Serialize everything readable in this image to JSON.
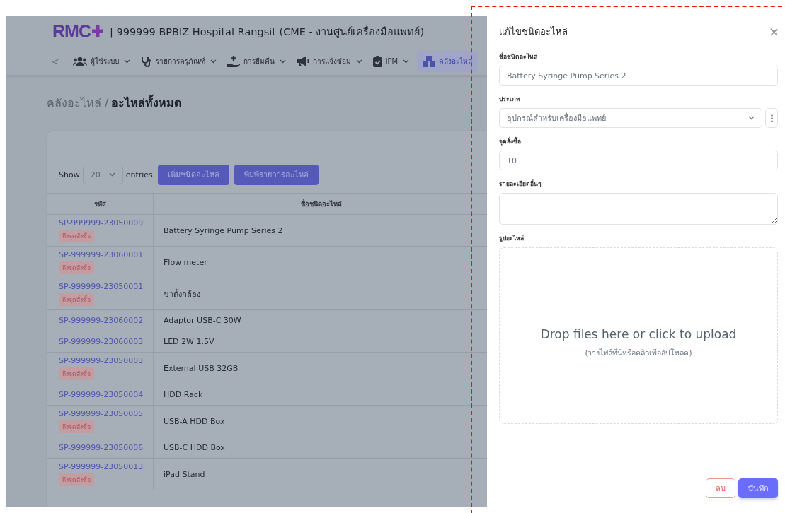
{
  "header": {
    "logo": "RMC",
    "title": "| 999999 BPBIZ Hospital Rangsit (CME - งานศูนย์เครื่องมือแพทย์)"
  },
  "nav": {
    "back": "<",
    "items": [
      {
        "label": "ผู้ใช้ระบบ",
        "selected": false
      },
      {
        "label": "รายการครุภัณฑ์",
        "selected": false
      },
      {
        "label": "การยืมคืน",
        "selected": false
      },
      {
        "label": "การแจ้งซ่อม",
        "selected": false
      },
      {
        "label": "iPM",
        "selected": false
      },
      {
        "label": "คลังอะไหล",
        "selected": true
      }
    ]
  },
  "breadcrumb": {
    "parent": "คลังอะไหล่ /",
    "current": "อะไหล่ทั้งหมด"
  },
  "controls": {
    "show": "Show",
    "page_size": "20",
    "entries": "entries",
    "buttons": [
      "เพิ่มชนิดอะไหล่",
      "พิมพ์รายการอะไหล่"
    ]
  },
  "table": {
    "columns": [
      "รหัส",
      "ชื่อชนิดอะไหล่"
    ],
    "rows": [
      {
        "code": "SP-999999-23050009",
        "badge": "ถึงจุดสั่งซื้อ",
        "name": "Battery Syringe Pump Series 2"
      },
      {
        "code": "SP-999999-23060001",
        "badge": "ถึงจุดสั่งซื้อ",
        "name": "Flow meter"
      },
      {
        "code": "SP-999999-23050001",
        "badge": "ถึงจุดสั่งซื้อ",
        "name": "ขาตั้งกล้อง"
      },
      {
        "code": "SP-999999-23060002",
        "name": "Adaptor USB-C 30W"
      },
      {
        "code": "SP-999999-23060003",
        "name": "LED 2W 1.5V"
      },
      {
        "code": "SP-999999-23050003",
        "badge": "ถึงจุดสั่งซื้อ",
        "name": "External USB 32GB"
      },
      {
        "code": "SP-999999-23050004",
        "name": "HDD Rack"
      },
      {
        "code": "SP-999999-23050005",
        "badge": "ถึงจุดสั่งซื้อ",
        "name": "USB-A HDD Box"
      },
      {
        "code": "SP-999999-23050006",
        "name": "USB-C HDD Box"
      },
      {
        "code": "SP-999999-23050013",
        "badge": "ถึงจุดสั่งซื้อ",
        "name": "iPad Stand"
      }
    ]
  },
  "drawer": {
    "title": "แก้ไขชนิดอะไหล่",
    "close": "×",
    "fields": [
      {
        "kind": "text",
        "label": "ชื่อชนิดอะไหล่",
        "value": "Battery Syringe Pump Series 2"
      },
      {
        "kind": "select",
        "label": "ประเภท",
        "value": "อุปกรณ์สำหรับเครื่องมือแพทย์"
      },
      {
        "kind": "text",
        "label": "จุดสั่งซื้อ",
        "value": "10"
      },
      {
        "kind": "textarea",
        "label": "รายละเอียดอื่นๆ"
      },
      {
        "kind": "upload",
        "label": "รูปอะไหล่",
        "prompt": "Drop files here or click to upload",
        "hint": "(วางไฟล์ที่นี่หรือคลิกเพื่ออัปโหลด)"
      }
    ],
    "buttons": [
      {
        "kind": "danger",
        "label": "ลบ"
      },
      {
        "kind": "primary",
        "label": "บันทึก"
      }
    ]
  }
}
